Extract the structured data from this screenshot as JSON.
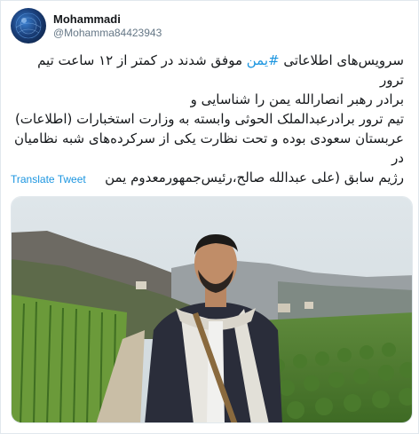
{
  "user": {
    "display_name": "Mohammadi",
    "handle": "@Mohamma84423943"
  },
  "tweet": {
    "hashtag": "#یمن",
    "line1_before": "سرویس‌های اطلاعاتی ",
    "line1_after": " موفق شدند در کمتر از ۱۲ ساعت تیم ترور",
    "line2": "برادر رهبر انصارالله یمن را شناسایی و",
    "line3": "تیم ترور برادرعبدالملک الحوثی وابسته به وزارت استخبارات (اطلاعات)",
    "line4": "عربستان سعودی بوده و تحت نظارت یکی از سرکرده‌های شبه نظامیان در",
    "line5": "رژیم سابق (علی عبدالله صالح،رئیس‌جمهورمعدوم یمن"
  },
  "actions": {
    "translate_label": "Translate Tweet"
  },
  "media": {
    "description_icon": "photo"
  }
}
